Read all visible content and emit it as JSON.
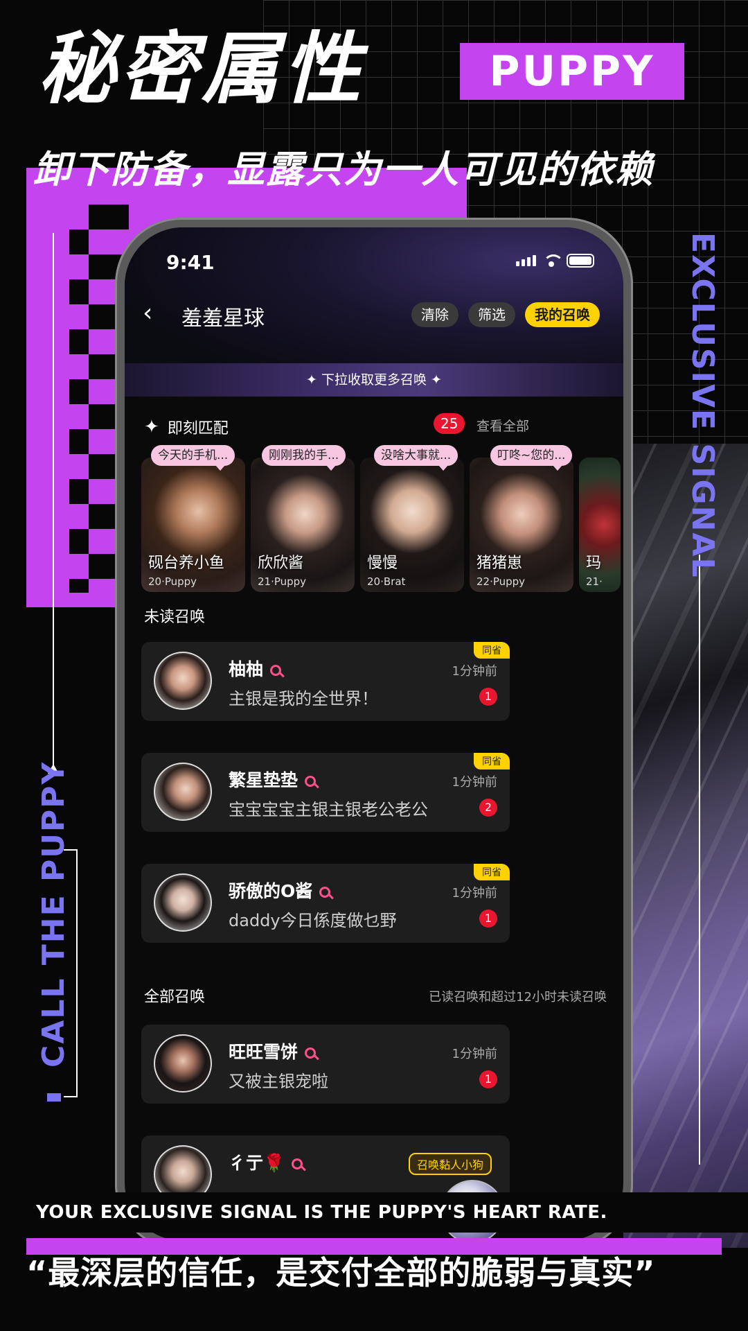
{
  "poster": {
    "title": "秘密属性",
    "badge": "PUPPY",
    "subtitle": "卸下防备，显露只为一人可见的依赖",
    "side_right": "EXCLUSIVE SIGNAL",
    "side_left": "CALL THE PUPPY",
    "tagline": "YOUR EXCLUSIVE SIGNAL IS THE PUPPY'S HEART RATE.",
    "quote": "“最深层的信任，是交付全部的脆弱与真实”",
    "colors": {
      "accent_purple": "#c444f0",
      "accent_violet": "#7a74f0",
      "accent_yellow": "#ffd200",
      "badge_red": "#e8162e"
    }
  },
  "status_bar": {
    "time": "9:41"
  },
  "header": {
    "title": "羞羞星球",
    "clear_label": "清除",
    "filter_label": "筛选",
    "mine_label": "我的召唤",
    "back_icon": "chevron-left-icon"
  },
  "banner": {
    "text": "下拉收取更多召唤"
  },
  "match": {
    "label": "即刻匹配",
    "count": "25",
    "view_all": "查看全部",
    "cards": [
      {
        "bubble": "今天的手机...",
        "name": "砚台养小鱼",
        "meta": "20·Puppy"
      },
      {
        "bubble": "刚刚我的手...",
        "name": "欣欣酱",
        "meta": "21·Puppy"
      },
      {
        "bubble": "没啥大事就...",
        "name": "慢慢",
        "meta": "20·Brat"
      },
      {
        "bubble": "叮咚~您的...",
        "name": "猪猪崽",
        "meta": "22·Puppy"
      },
      {
        "bubble": "",
        "name": "玛",
        "meta": "21·"
      }
    ]
  },
  "unread": {
    "label": "未读召唤",
    "items": [
      {
        "name": "柚柚",
        "message": "主银是我的全世界！",
        "time": "1分钟前",
        "count": "1",
        "tag": "同省"
      },
      {
        "name": "繁星垫垫",
        "message": "宝宝宝宝主银主银老公老公",
        "time": "1分钟前",
        "count": "2",
        "tag": "同省"
      },
      {
        "name": "骄傲的O酱",
        "message": "daddy今日係度做乜野",
        "time": "1分钟前",
        "count": "1",
        "tag": "同省"
      }
    ]
  },
  "all": {
    "label": "全部召唤",
    "note": "已读召唤和超过12小时未读召唤",
    "items": [
      {
        "name": "旺旺雪饼",
        "message": "又被主银宠啦",
        "time": "1分钟前",
        "count": "1"
      },
      {
        "name": "彳亍🌹"
      }
    ]
  },
  "floating": {
    "label": "召唤黏人小狗"
  }
}
